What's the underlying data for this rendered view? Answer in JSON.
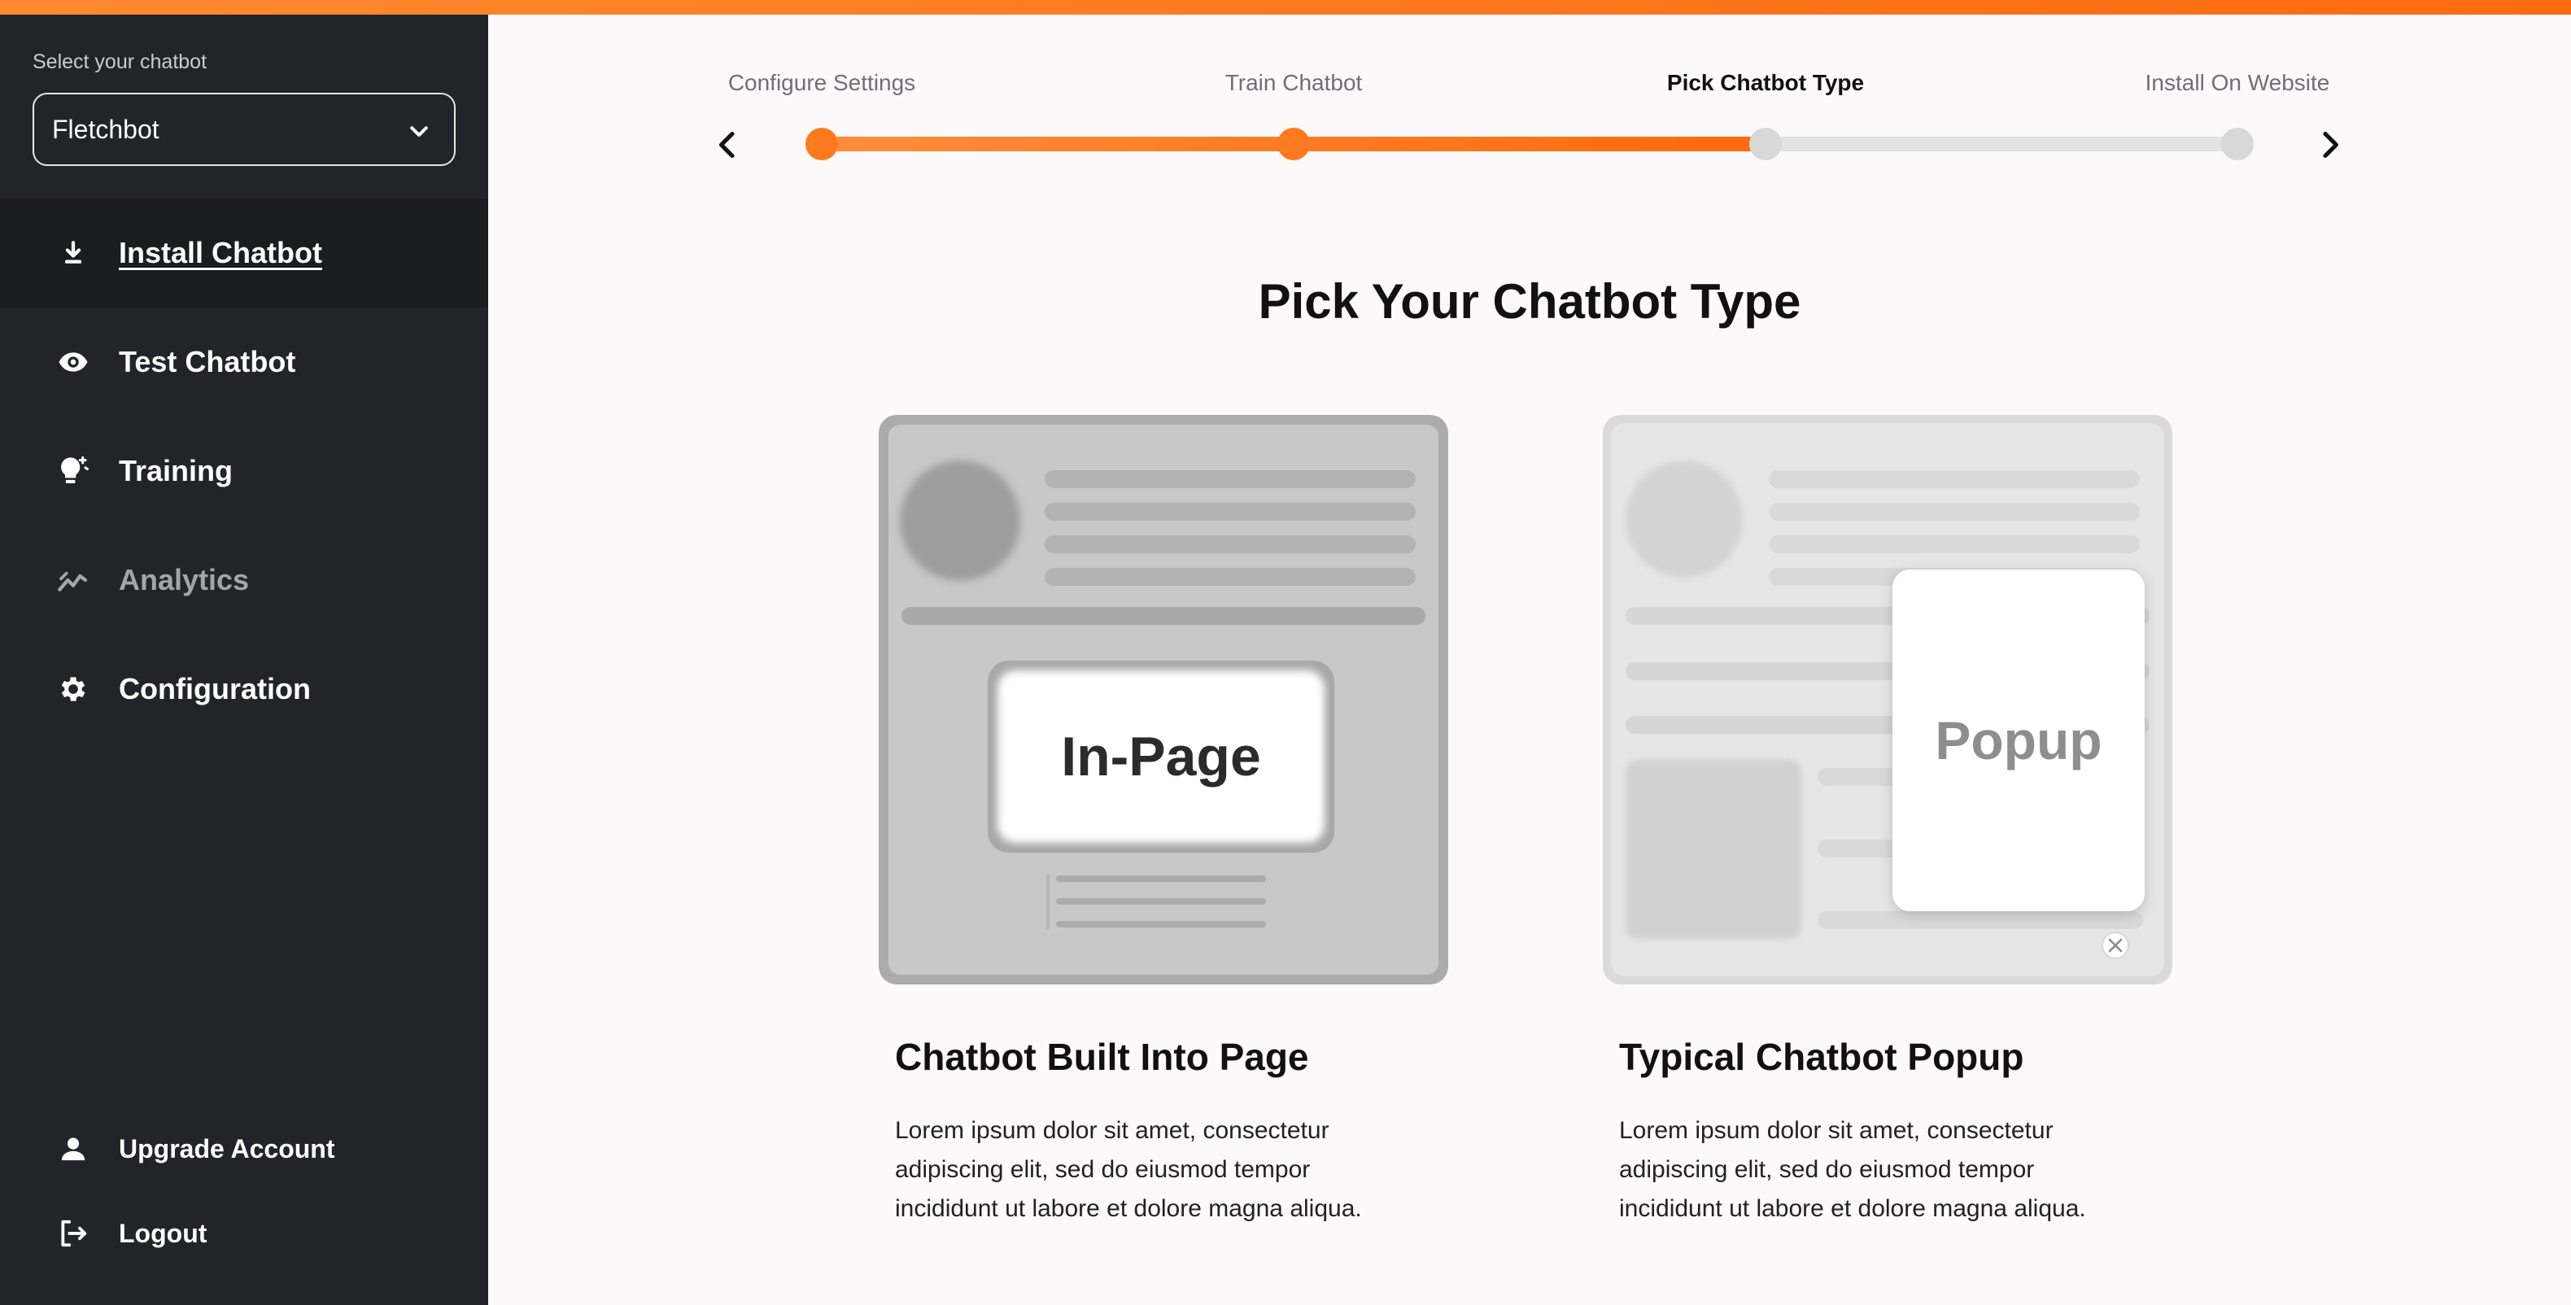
{
  "sidebar": {
    "select_label": "Select your chatbot",
    "selected_chatbot": "Fletchbot",
    "items": [
      {
        "label": "Install Chatbot"
      },
      {
        "label": "Test Chatbot"
      },
      {
        "label": "Training"
      },
      {
        "label": "Analytics"
      },
      {
        "label": "Configuration"
      }
    ],
    "bottom": [
      {
        "label": "Upgrade Account"
      },
      {
        "label": "Logout"
      }
    ]
  },
  "stepper": {
    "steps": [
      "Configure Settings",
      "Train Chatbot",
      "Pick Chatbot Type",
      "Install On Website"
    ],
    "current_step": 3,
    "progress": 0.6667
  },
  "main": {
    "title": "Pick Your Chatbot Type",
    "cards": [
      {
        "preview_text": "In-Page",
        "title": "Chatbot Built Into Page",
        "description": "Lorem ipsum dolor sit amet, consectetur adipiscing elit, sed do eiusmod tempor incididunt ut labore et dolore magna aliqua."
      },
      {
        "preview_text": "Popup",
        "title": "Typical Chatbot Popup",
        "description": "Lorem ipsum dolor sit amet, consectetur adipiscing elit, sed do eiusmod tempor incididunt ut labore et dolore magna aliqua."
      }
    ]
  },
  "colors": {
    "accent": "#ff7a1f",
    "sidebar": "#212429",
    "background": "#fbf9f9"
  }
}
